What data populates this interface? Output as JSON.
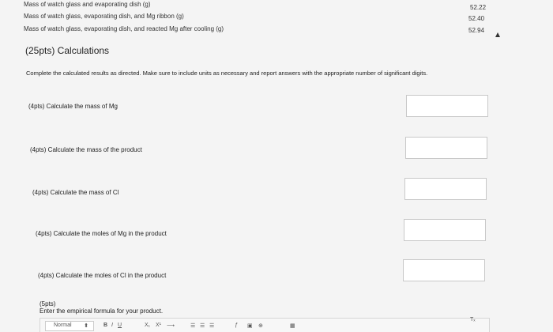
{
  "data_table": [
    {
      "label": "Mass of watch glass and evaporating dish (g)",
      "value": "52.22"
    },
    {
      "label": "Mass of watch glass, evaporating dish, and Mg ribbon (g)",
      "value": "52.40"
    },
    {
      "label": "Mass of watch glass, evaporating dish, and reacted Mg after cooling (g)",
      "value": "52.94"
    }
  ],
  "section": {
    "title": "(25pts) Calculations",
    "instructions": "Complete the calculated results as directed. Make sure to include units as necessary and report answers with the appropriate number of significant digits."
  },
  "questions": [
    {
      "label": "(4pts)  Calculate the mass of Mg",
      "value": ""
    },
    {
      "label": "(4pts)  Calculate the mass of the product",
      "value": ""
    },
    {
      "label": "(4pts)  Calculate the mass of Cl",
      "value": ""
    },
    {
      "label": "(4pts)  Calculate the moles of Mg in the product",
      "value": ""
    },
    {
      "label": "(4pts)  Calculate the moles of Cl in the product",
      "value": ""
    }
  ],
  "final_question": {
    "points": "(5pts)",
    "prompt": "Enter the empirical formula for your product."
  },
  "editor_toolbar": {
    "format_select": "Normal",
    "select_arrow": "⬍",
    "bold": "B",
    "italic": "I",
    "underline": "U",
    "subscript": "X₁",
    "superscript": "X¹",
    "arrow": "⟶",
    "ordered_list": "☰",
    "unordered_list": "☰",
    "align": "☰",
    "formula": "ƒ",
    "image": "▣",
    "link": "⊕",
    "table": "▦",
    "clear_format": "Tₓ"
  }
}
